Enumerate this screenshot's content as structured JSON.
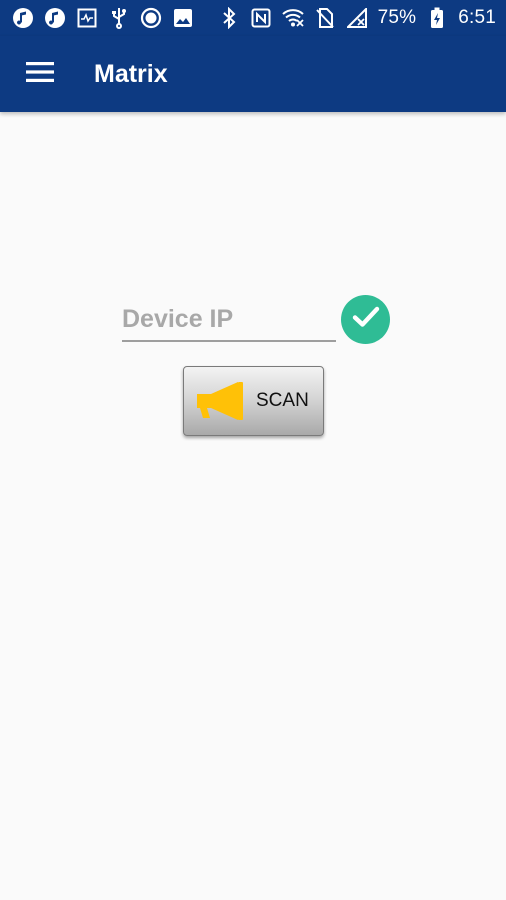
{
  "status_bar": {
    "left_icons": [
      "music-note-icon",
      "music-note-icon",
      "activity-monitor-icon",
      "usb-icon",
      "radio-button-icon",
      "image-icon"
    ],
    "right_icons": [
      "bluetooth-icon",
      "nfc-icon",
      "wifi-off-icon",
      "no-sim-icon",
      "cellular-no-signal-icon"
    ],
    "battery": "75%",
    "battery_icon": "battery-charging-icon",
    "time": "6:51"
  },
  "app_bar": {
    "title": "Matrix",
    "menu_icon": "hamburger-menu-icon",
    "color": "#0d3a82"
  },
  "form": {
    "ip_placeholder": "Device IP",
    "ip_value": "",
    "confirm_icon": "check-circle-icon",
    "confirm_color": "#2fbc95",
    "scan_label": "SCAN",
    "scan_icon": "megaphone-icon",
    "scan_icon_color": "#ffc107"
  }
}
